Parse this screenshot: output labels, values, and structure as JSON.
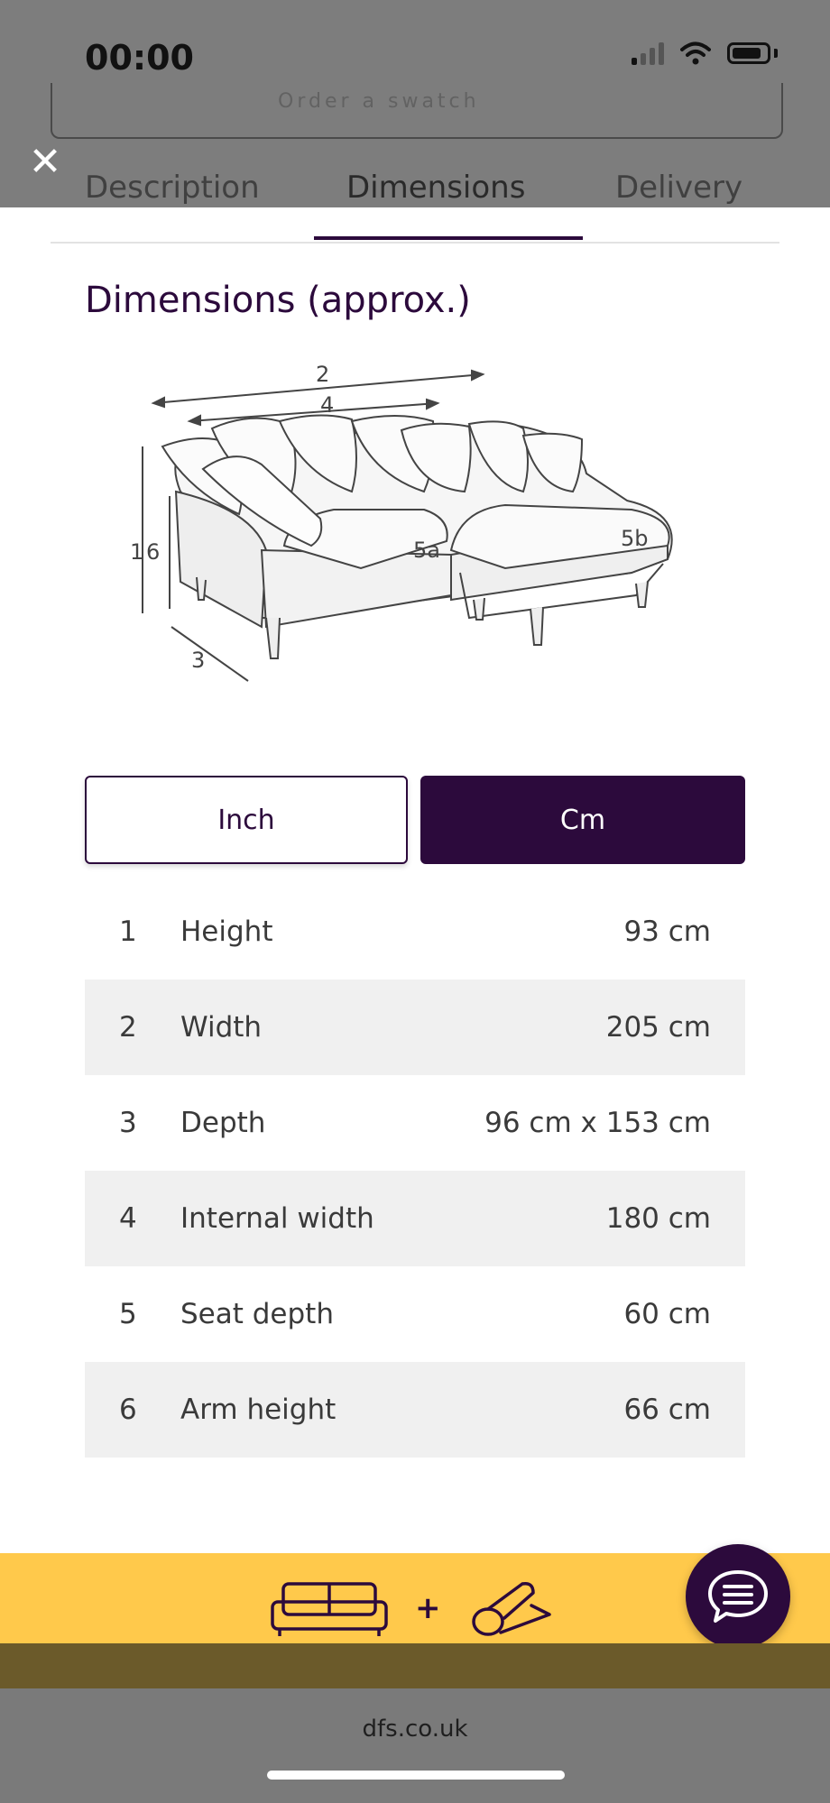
{
  "status_bar": {
    "time": "00:00"
  },
  "background": {
    "order_label": "Order a swatch"
  },
  "tabs": [
    {
      "label": "Description"
    },
    {
      "label": "Dimensions"
    },
    {
      "label": "Delivery"
    }
  ],
  "section": {
    "title": "Dimensions (approx.)"
  },
  "diagram_labels": {
    "d1": "1",
    "d2": "2",
    "d3": "3",
    "d4": "4",
    "d5a": "5a",
    "d5b": "5b",
    "d6": "6"
  },
  "unit_toggle": {
    "inch_label": "Inch",
    "cm_label": "Cm",
    "selected": "Cm"
  },
  "dimensions": [
    {
      "num": "1",
      "label": "Height",
      "value": "93 cm"
    },
    {
      "num": "2",
      "label": "Width",
      "value": "205 cm"
    },
    {
      "num": "3",
      "label": "Depth",
      "value": "96 cm x 153 cm"
    },
    {
      "num": "4",
      "label": "Internal width",
      "value": "180 cm"
    },
    {
      "num": "5",
      "label": "Seat depth",
      "value": "60 cm"
    },
    {
      "num": "6",
      "label": "Arm height",
      "value": "66 cm"
    }
  ],
  "banner": {
    "icons": [
      "sofa-icon",
      "rug-icon"
    ],
    "plus": "+"
  },
  "browser": {
    "url": "dfs.co.uk"
  },
  "colors": {
    "brand_purple": "#2c0a3c",
    "banner_yellow": "#ffc94b"
  }
}
